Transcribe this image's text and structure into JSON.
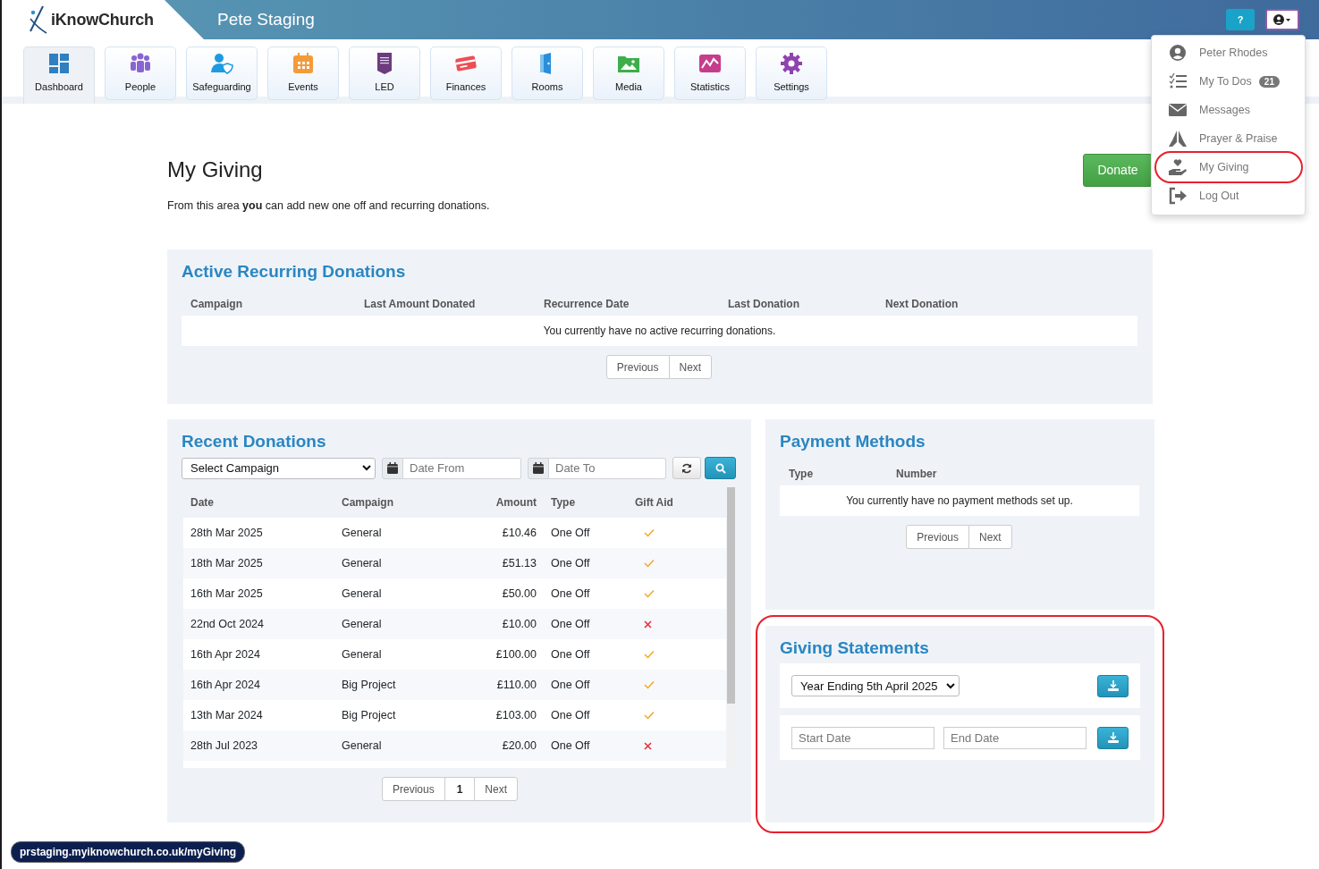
{
  "header": {
    "logo": "iKnowChurch",
    "site_title": "Pete Staging",
    "help_label": "?"
  },
  "nav": [
    {
      "label": "Dashboard",
      "selected": true
    },
    {
      "label": "People",
      "selected": false
    },
    {
      "label": "Safeguarding",
      "selected": false
    },
    {
      "label": "Events",
      "selected": false
    },
    {
      "label": "LED",
      "selected": false
    },
    {
      "label": "Finances",
      "selected": false
    },
    {
      "label": "Rooms",
      "selected": false
    },
    {
      "label": "Media",
      "selected": false
    },
    {
      "label": "Statistics",
      "selected": false
    },
    {
      "label": "Settings",
      "selected": false
    }
  ],
  "user_menu": {
    "expanded": true,
    "items": [
      {
        "label": "Peter Rhodes",
        "annotated": false
      },
      {
        "label": "My To Dos",
        "badge": "21",
        "annotated": false
      },
      {
        "label": "Messages",
        "annotated": false
      },
      {
        "label": "Prayer & Praise",
        "annotated": false
      },
      {
        "label": "My Giving",
        "annotated": true
      },
      {
        "label": "Log Out",
        "annotated": false
      }
    ]
  },
  "page": {
    "title": "My Giving",
    "intro": "From this area **you** can add new one off and recurring donations.",
    "donate_button": "Donate"
  },
  "recurring": {
    "title": "Active Recurring Donations",
    "columns": [
      "Campaign",
      "Last Amount Donated",
      "Recurrence Date",
      "Last Donation",
      "Next Donation"
    ],
    "empty_message": "You currently have no active recurring donations.",
    "pager": [
      "Previous",
      "Next"
    ]
  },
  "recent": {
    "title": "Recent Donations",
    "campaign_select": "Select Campaign",
    "date_from": {
      "placeholder": "Date From"
    },
    "date_to": {
      "placeholder": "Date To"
    },
    "columns": [
      "Date",
      "Campaign",
      "Amount",
      "Type",
      "Gift Aid"
    ],
    "rows": [
      {
        "date": "28th Mar 2025",
        "campaign": "General",
        "amount": "£10.46",
        "type": "One Off",
        "gift_aid": true
      },
      {
        "date": "18th Mar 2025",
        "campaign": "General",
        "amount": "£51.13",
        "type": "One Off",
        "gift_aid": true
      },
      {
        "date": "16th Mar 2025",
        "campaign": "General",
        "amount": "£50.00",
        "type": "One Off",
        "gift_aid": true
      },
      {
        "date": "22nd Oct 2024",
        "campaign": "General",
        "amount": "£10.00",
        "type": "One Off",
        "gift_aid": false
      },
      {
        "date": "16th Apr 2024",
        "campaign": "General",
        "amount": "£100.00",
        "type": "One Off",
        "gift_aid": true
      },
      {
        "date": "16th Apr 2024",
        "campaign": "Big Project",
        "amount": "£110.00",
        "type": "One Off",
        "gift_aid": true
      },
      {
        "date": "13th Mar 2024",
        "campaign": "Big Project",
        "amount": "£103.00",
        "type": "One Off",
        "gift_aid": true
      },
      {
        "date": "28th Jul 2023",
        "campaign": "General",
        "amount": "£20.00",
        "type": "One Off",
        "gift_aid": false
      }
    ],
    "pager": [
      {
        "label": "Previous",
        "selected": false
      },
      {
        "label": "1",
        "selected": true
      },
      {
        "label": "Next",
        "selected": false
      }
    ]
  },
  "payment_methods": {
    "title": "Payment Methods",
    "columns": [
      "Type",
      "Number"
    ],
    "empty_message": "You currently have no payment methods set up.",
    "pager": [
      "Previous",
      "Next"
    ]
  },
  "statements": {
    "title": "Giving Statements",
    "annotated": true,
    "year_select": "Year Ending 5th April 2025",
    "start_date": {
      "placeholder": "Start Date"
    },
    "end_date": {
      "placeholder": "End Date"
    }
  },
  "status_url": "prstaging.myiknowchurch.co.uk/myGiving"
}
